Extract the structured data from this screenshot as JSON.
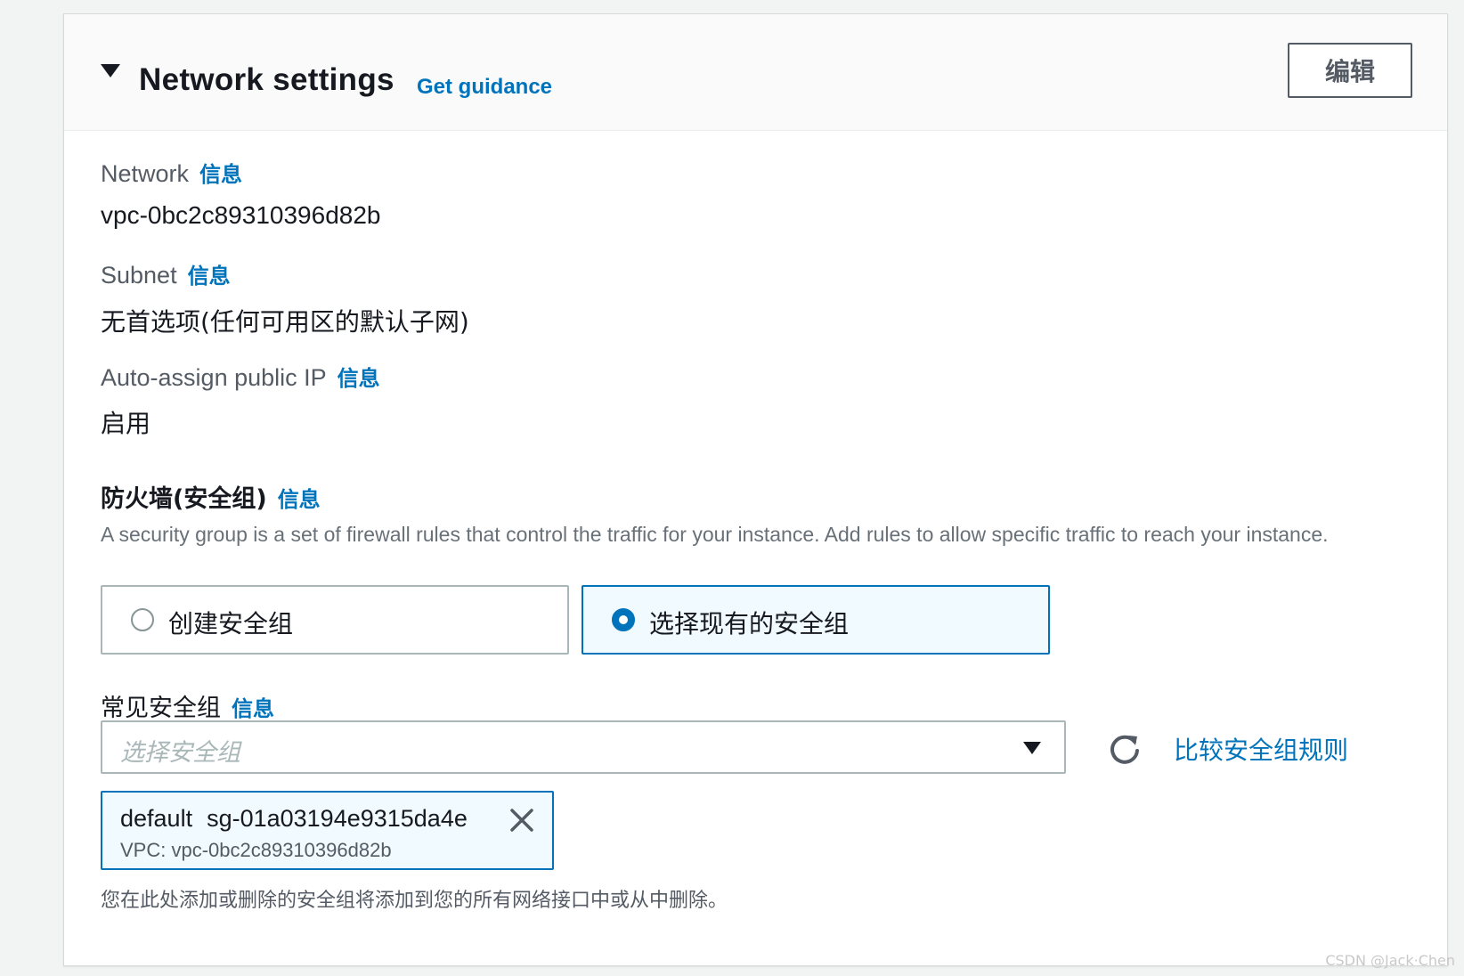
{
  "section": {
    "title": "Network settings",
    "guidance_link": "Get guidance",
    "edit_button": "编辑"
  },
  "info_label": "信息",
  "fields": {
    "network": {
      "label": "Network",
      "value": "vpc-0bc2c89310396d82b"
    },
    "subnet": {
      "label": "Subnet",
      "value": "无首选项(任何可用区的默认子网)"
    },
    "auto_assign_ip": {
      "label": "Auto-assign public IP",
      "value": "启用"
    }
  },
  "firewall": {
    "label": "防火墙(安全组)",
    "description": "A security group is a set of firewall rules that control the traffic for your instance. Add rules to allow specific traffic to reach your instance.",
    "options": [
      {
        "label": "创建安全组",
        "selected": false
      },
      {
        "label": "选择现有的安全组",
        "selected": true
      }
    ]
  },
  "common_groups": {
    "label": "常见安全组",
    "placeholder": "选择安全组",
    "compare_link": "比较安全组规则",
    "selected_token": {
      "name": "default",
      "id": "sg-01a03194e9315da4e",
      "vpc": "VPC: vpc-0bc2c89310396d82b"
    },
    "footnote": "您在此处添加或删除的安全组将添加到您的所有网络接口中或从中删除。"
  },
  "watermark": "CSDN @Jack·Chen"
}
